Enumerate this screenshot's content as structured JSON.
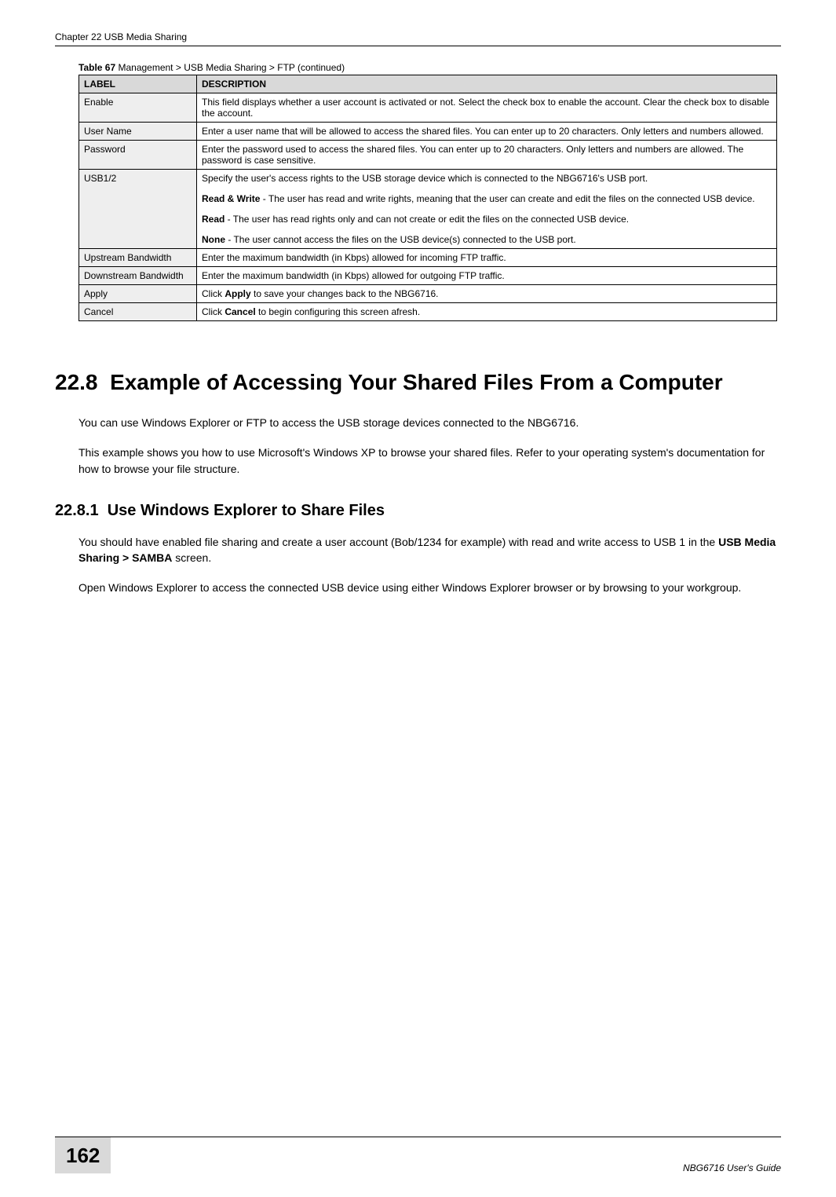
{
  "header": {
    "chapter": "Chapter 22 USB Media Sharing"
  },
  "table": {
    "caption_prefix": "Table 67",
    "caption_rest": "   Management >  USB Media Sharing > FTP (continued)",
    "head_label": "LABEL",
    "head_desc": "DESCRIPTION",
    "rows": [
      {
        "label": "Enable",
        "desc": [
          "This field displays whether a user account is activated or not. Select the check box to enable the account. Clear the check box to disable the account."
        ]
      },
      {
        "label": "User Name",
        "desc": [
          "Enter a user name that will be allowed to access the shared files. You can enter up to 20 characters. Only letters and numbers allowed."
        ]
      },
      {
        "label": "Password",
        "desc": [
          "Enter the password used to access the shared files. You can enter up to 20 characters. Only letters and numbers are allowed. The password is case sensitive."
        ]
      },
      {
        "label": "USB1/2",
        "desc": [
          "Specify the user's access rights to the USB storage device which is connected to the NBG6716's USB port.",
          "<b>Read & Write</b> - The user has read and write rights, meaning that the user can create and edit the files on the connected USB device.",
          "<b>Read</b> - The user has read rights only and can not create or edit the files on the connected USB device.",
          "<b>None</b> - The user cannot access the files on the USB device(s) connected to the USB port."
        ]
      },
      {
        "label": "Upstream Bandwidth",
        "desc": [
          "Enter the maximum bandwidth (in Kbps) allowed for incoming FTP traffic."
        ]
      },
      {
        "label": "Downstream Bandwidth",
        "desc": [
          "Enter the maximum bandwidth (in Kbps) allowed for outgoing FTP traffic."
        ]
      },
      {
        "label": "Apply",
        "desc": [
          "Click <b>Apply</b> to save your changes back to the NBG6716."
        ]
      },
      {
        "label": "Cancel",
        "desc": [
          "Click <b>Cancel</b> to begin configuring this screen afresh."
        ]
      }
    ]
  },
  "section": {
    "number": "22.8",
    "title": "Example of Accessing Your Shared Files From a Computer",
    "paras": [
      "You can use Windows Explorer or FTP to access the USB storage devices connected to the NBG6716.",
      "This example shows you how to use Microsoft's Windows XP to browse your shared files. Refer to your operating system's documentation for how to browse your file structure."
    ]
  },
  "subsection": {
    "number": "22.8.1",
    "title": "Use Windows Explorer to Share Files",
    "paras": [
      "You should have enabled file sharing and create a user account (Bob/1234 for example) with read and write access to USB 1 in the <b>USB Media Sharing > SAMBA</b> screen.",
      "Open Windows Explorer to access the connected USB device using either Windows Explorer browser or by browsing to your workgroup."
    ]
  },
  "footer": {
    "page": "162",
    "guide": "NBG6716 User's Guide"
  }
}
